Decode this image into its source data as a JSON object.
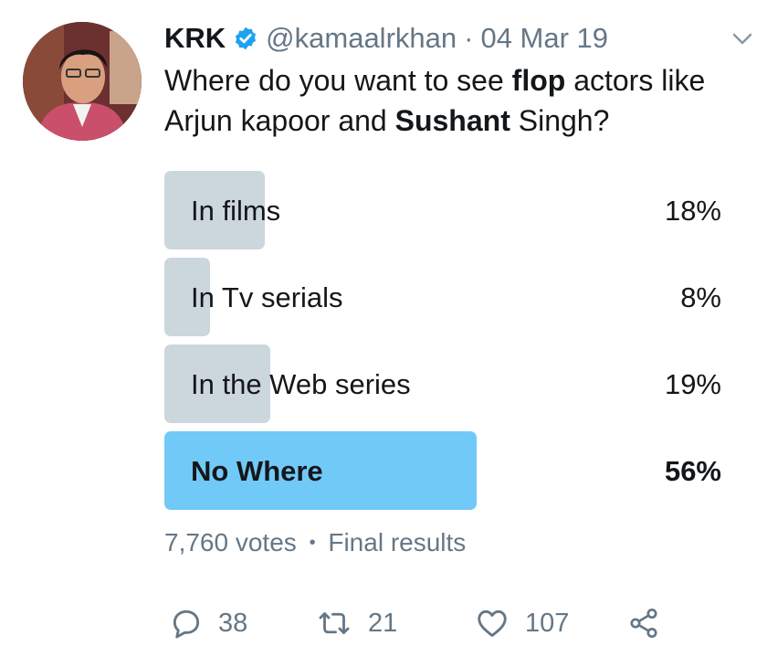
{
  "tweet": {
    "name": "KRK",
    "handle": "@kamaalrkhan",
    "separator": "·",
    "date": "04 Mar 19",
    "text_parts": [
      "Where do you want to see ",
      "flop",
      " actors like Arjun kapoor and ",
      "Sushant",
      " Singh?"
    ]
  },
  "poll": {
    "options": [
      {
        "label": "In films",
        "percent_text": "18%",
        "percent": 18,
        "winner": false
      },
      {
        "label": "In Tv serials",
        "percent_text": "8%",
        "percent": 8,
        "winner": false
      },
      {
        "label": "In the Web series",
        "percent_text": "19%",
        "percent": 19,
        "winner": false
      },
      {
        "label": "No Where",
        "percent_text": "56%",
        "percent": 56,
        "winner": true
      }
    ],
    "votes": "7,760 votes",
    "meta_sep": "•",
    "status": "Final results"
  },
  "actions": {
    "replies": "38",
    "retweets": "21",
    "likes": "107"
  },
  "icons": {
    "verified": "verified-badge-icon",
    "menu": "chevron-down-icon",
    "reply": "reply-icon",
    "retweet": "retweet-icon",
    "like": "heart-icon",
    "share": "share-icon"
  },
  "colors": {
    "poll_bar": "#ccd6dd",
    "poll_winner": "#71c9f8",
    "verified": "#1da1f2",
    "muted": "#657786"
  }
}
